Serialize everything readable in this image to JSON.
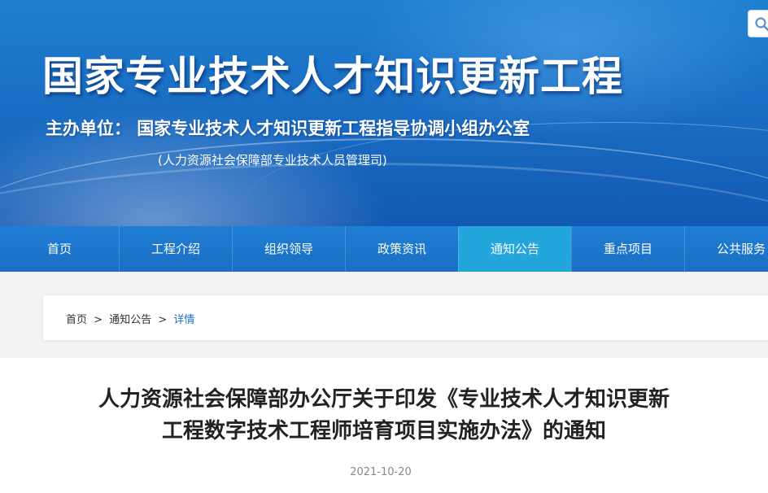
{
  "banner": {
    "title": "国家专业技术人才知识更新工程",
    "host_line": "主办单位：  国家专业技术人才知识更新工程指导协调小组办公室",
    "host_sub": "(人力资源社会保障部专业技术人员管理司)"
  },
  "search": {
    "icon": "search-icon"
  },
  "nav": {
    "items": [
      {
        "label": "首页"
      },
      {
        "label": "工程介绍"
      },
      {
        "label": "组织领导"
      },
      {
        "label": "政策资讯"
      },
      {
        "label": "通知公告"
      },
      {
        "label": "重点项目"
      },
      {
        "label": "公共服务"
      }
    ],
    "active_index": 4
  },
  "breadcrumb": {
    "items": [
      "首页",
      "通知公告",
      "详情"
    ],
    "separator": ">"
  },
  "article": {
    "title_line1": "人力资源社会保障部办公厅关于印发《专业技术人才知识更新",
    "title_line2": "工程数字技术工程师培育项目实施办法》的通知",
    "date": "2021-10-20"
  },
  "colors": {
    "nav_active": "#22a6dc",
    "brand_blue": "#1a6fc5",
    "crumb_current": "#1a6fc5"
  }
}
